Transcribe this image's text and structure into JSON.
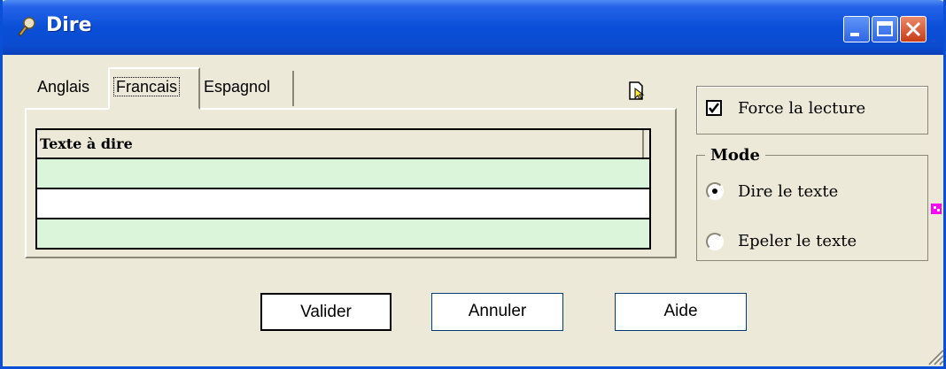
{
  "window": {
    "title": "Dire"
  },
  "tabs": [
    {
      "label": "Anglais"
    },
    {
      "label": "Francais"
    },
    {
      "label": "Espagnol"
    }
  ],
  "grid": {
    "header": "Texte à dire",
    "rows": [
      "",
      "",
      ""
    ]
  },
  "options": {
    "force_label": "Force la lecture",
    "force_checked": true
  },
  "mode": {
    "legend": "Mode",
    "items": [
      {
        "label": "Dire le texte",
        "selected": true
      },
      {
        "label": "Epeler le texte",
        "selected": false
      }
    ]
  },
  "buttons": {
    "validate": "Valider",
    "cancel": "Annuler",
    "help": "Aide"
  },
  "colors": {
    "title_bar": "#0a4fd8",
    "row_green": "#dbf5db",
    "background": "#ece9d8"
  }
}
